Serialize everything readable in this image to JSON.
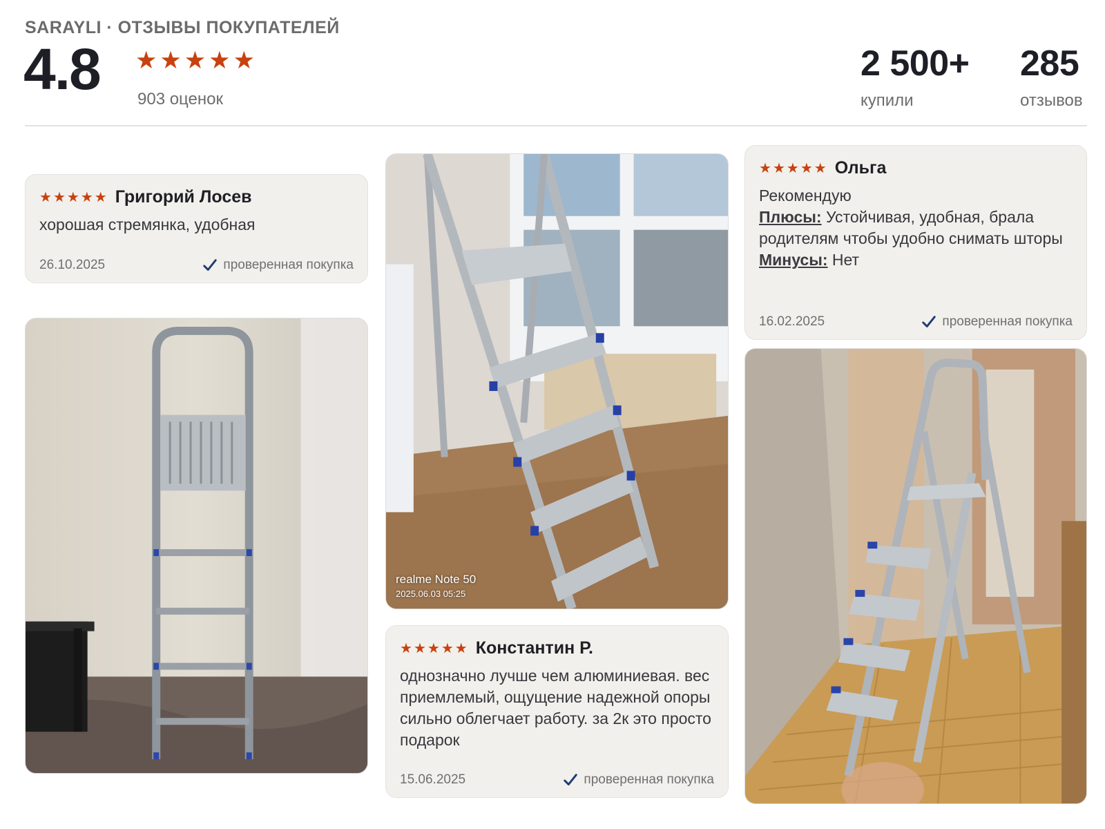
{
  "header": {
    "brand": "SARAYLI · ОТЗЫВЫ ПОКУПАТЕЛЕЙ",
    "score": "4.8",
    "stars": 5,
    "ratings_count": "903 оценок",
    "stats": [
      {
        "value": "2 500+",
        "label": "купили"
      },
      {
        "value": "285",
        "label": "отзывов"
      }
    ]
  },
  "reviews": [
    {
      "author": "Григорий Лосев",
      "stars": 5,
      "text": "хорошая стремянка, удобная",
      "date": "26.10.2025",
      "verified": "проверенная покупка"
    },
    {
      "author": "Константин Р.",
      "stars": 5,
      "text": "однозначно лучше чем алюминиевая. вес приемлемый, ощущение надежной опоры сильно облегчает работу. за 2к это просто подарок",
      "date": "15.06.2025",
      "verified": "проверенная покупка"
    },
    {
      "author": "Ольга",
      "stars": 5,
      "text": "Рекомендую",
      "pros_label": "Плюсы:",
      "pros": "Устойчивая, удобная, брала родителям чтобы удобно снимать шторы",
      "cons_label": "Минусы:",
      "cons": "Нет",
      "date": "16.02.2025",
      "verified": "проверенная покупка"
    }
  ],
  "photos": {
    "middle_watermark_line1": "realme Note 50",
    "middle_watermark_line2": "2025.06.03 05:25"
  },
  "colors": {
    "star": "#c8410f",
    "card_bg": "#f1f0ed",
    "check": "#1f3b73"
  }
}
